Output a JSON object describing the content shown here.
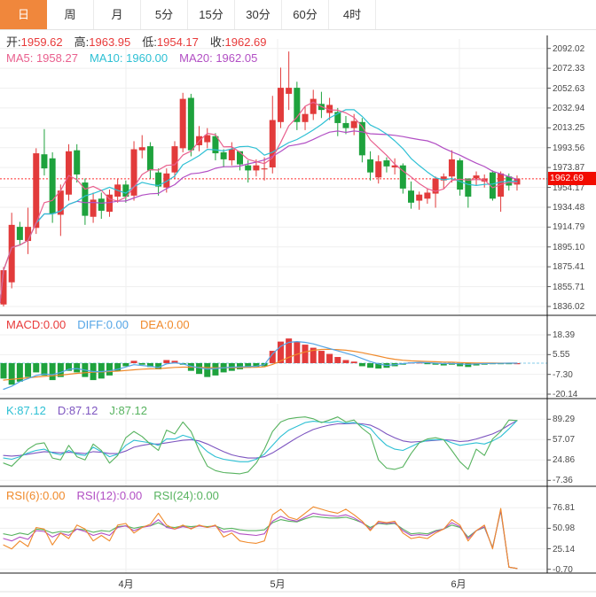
{
  "tabs": [
    {
      "label": "日",
      "selected": true
    },
    {
      "label": "周",
      "selected": false
    },
    {
      "label": "月",
      "selected": false
    },
    {
      "label": "5分",
      "selected": false
    },
    {
      "label": "15分",
      "selected": false
    },
    {
      "label": "30分",
      "selected": false
    },
    {
      "label": "60分",
      "selected": false
    },
    {
      "label": "4时",
      "selected": false
    }
  ],
  "ohlc_legend": [
    {
      "label": "开:",
      "value": "1959.62"
    },
    {
      "label": "高:",
      "value": "1963.95"
    },
    {
      "label": "低:",
      "value": "1954.17"
    },
    {
      "label": "收:",
      "value": "1962.69"
    }
  ],
  "ma_legend": [
    {
      "label": "MA5: ",
      "value": "1958.27",
      "color": "#e9608e"
    },
    {
      "label": "MA10: ",
      "value": "1960.00",
      "color": "#2ec0d4"
    },
    {
      "label": "MA20: ",
      "value": "1962.05",
      "color": "#b24fc4"
    }
  ],
  "macd_legend": [
    {
      "label": "MACD:",
      "value": "0.00",
      "color": "#e83a3a"
    },
    {
      "label": "DIFF:",
      "value": "0.00",
      "color": "#54a5e6"
    },
    {
      "label": "DEA:",
      "value": "0.00",
      "color": "#f08a2b"
    }
  ],
  "kdj_legend": [
    {
      "label": "K:",
      "value": "87.12",
      "color": "#2ec0d4"
    },
    {
      "label": "D:",
      "value": "87.12",
      "color": "#7d55c0"
    },
    {
      "label": "J:",
      "value": "87.12",
      "color": "#57b35f"
    }
  ],
  "rsi_legend": [
    {
      "label": "RSI(6):",
      "value": "0.00",
      "color": "#f08a2b"
    },
    {
      "label": "RSI(12):",
      "value": "0.00",
      "color": "#b24fc4"
    },
    {
      "label": "RSI(24):",
      "value": "0.00",
      "color": "#57b35f"
    }
  ],
  "current_price": "1962.69",
  "x_labels": [
    {
      "text": "4月",
      "x": 142
    },
    {
      "text": "5月",
      "x": 313
    },
    {
      "text": "6月",
      "x": 517
    }
  ],
  "colors": {
    "up": "#e23b3b",
    "down": "#1ea23d",
    "accent_tab": "#f0873c",
    "badge": "#f20c00",
    "grid": "#efefef",
    "panel_border": "#1a1a1a",
    "dotted_price_line": "#ff2d2d",
    "macd_zero_line": "#85cdea"
  },
  "chart_data": [
    {
      "type": "candlestick",
      "panel": "main",
      "y_ticks": [
        2092.02,
        2072.33,
        2052.63,
        2032.94,
        2013.25,
        1993.56,
        1973.87,
        1954.17,
        1934.48,
        1914.79,
        1895.1,
        1875.41,
        1855.71,
        1836.02
      ],
      "ylim": [
        1836.02,
        2092.02
      ],
      "x_tick_labels": [
        "4月",
        "5月",
        "6月"
      ],
      "current_price_line": 1962.69,
      "ma_overlays": [
        {
          "name": "MA5",
          "period": 5,
          "color": "#e9608e"
        },
        {
          "name": "MA10",
          "period": 10,
          "color": "#2ec0d4"
        },
        {
          "name": "MA20",
          "period": 20,
          "color": "#b24fc4"
        }
      ],
      "candles_ochl_note": "each row is [open, close, low, high]",
      "candles": [
        [
          1838,
          1872,
          1836,
          1875
        ],
        [
          1860,
          1917,
          1854,
          1929
        ],
        [
          1915,
          1902,
          1897,
          1920
        ],
        [
          1901,
          1915,
          1888,
          1934
        ],
        [
          1914,
          1988,
          1908,
          1993
        ],
        [
          1987,
          1973,
          1966,
          2012
        ],
        [
          1983,
          1928,
          1919,
          1989
        ],
        [
          1927,
          1951,
          1906,
          1957
        ],
        [
          1947,
          1990,
          1941,
          1997
        ],
        [
          1991,
          1967,
          1959,
          1997
        ],
        [
          1959,
          1926,
          1917,
          1963
        ],
        [
          1925,
          1942,
          1919,
          1949
        ],
        [
          1943,
          1931,
          1923,
          1949
        ],
        [
          1930,
          1947,
          1925,
          1952
        ],
        [
          1945,
          1957,
          1939,
          1963
        ],
        [
          1957,
          1945,
          1939,
          1961
        ],
        [
          1946,
          1992,
          1941,
          2000
        ],
        [
          1991,
          1994,
          1983,
          2006
        ],
        [
          1995,
          1971,
          1963,
          1999
        ],
        [
          1969,
          1955,
          1946,
          1973
        ],
        [
          1954,
          1968,
          1949,
          1973
        ],
        [
          1969,
          1995,
          1963,
          2000
        ],
        [
          1993,
          2042,
          1989,
          2048
        ],
        [
          2043,
          1991,
          1985,
          2047
        ],
        [
          1996,
          2005,
          1990,
          2015
        ],
        [
          1999,
          2006,
          1993,
          2013
        ],
        [
          2005,
          1988,
          1981,
          2008
        ],
        [
          1989,
          1982,
          1974,
          1992
        ],
        [
          1981,
          1992,
          1976,
          1999
        ],
        [
          1990,
          1977,
          1971,
          1990
        ],
        [
          1976,
          1971,
          1959,
          1981
        ],
        [
          1971,
          1976,
          1965,
          1982
        ],
        [
          1972,
          1973,
          1961,
          1984
        ],
        [
          1974,
          2021,
          1968,
          2045
        ],
        [
          2019,
          2053,
          2013,
          2073
        ],
        [
          2047,
          2053,
          2031,
          2089
        ],
        [
          2053,
          2019,
          2011,
          2059
        ],
        [
          2019,
          2027,
          2011,
          2035
        ],
        [
          2027,
          2042,
          2021,
          2051
        ],
        [
          2037,
          2031,
          2023,
          2049
        ],
        [
          2028,
          2036,
          2021,
          2043
        ],
        [
          2029,
          2018,
          2005,
          2033
        ],
        [
          2018,
          2013,
          2007,
          2025
        ],
        [
          2013,
          2020,
          2006,
          2027
        ],
        [
          2019,
          1986,
          1979,
          2023
        ],
        [
          1982,
          1969,
          1961,
          1990
        ],
        [
          1964,
          1980,
          1958,
          1986
        ],
        [
          1981,
          1975,
          1969,
          1984
        ],
        [
          1974,
          1976,
          1967,
          1983
        ],
        [
          1976,
          1953,
          1948,
          1978
        ],
        [
          1951,
          1939,
          1933,
          1960
        ],
        [
          1941,
          1947,
          1932,
          1950
        ],
        [
          1943,
          1949,
          1938,
          1953
        ],
        [
          1948,
          1963,
          1934,
          1965
        ],
        [
          1961,
          1965,
          1953,
          1968
        ],
        [
          1965,
          1982,
          1959,
          1991
        ],
        [
          1981,
          1952,
          1946,
          1983
        ],
        [
          1963,
          1945,
          1934,
          1963
        ],
        [
          1963,
          1966,
          1956,
          1970
        ],
        [
          1960,
          1963,
          1954,
          1967
        ],
        [
          1969,
          1943,
          1941,
          1971
        ],
        [
          1945,
          1968,
          1930,
          1970
        ],
        [
          1965,
          1956,
          1951,
          1968
        ],
        [
          1957,
          1963,
          1951,
          1966
        ]
      ]
    },
    {
      "type": "bar",
      "panel": "macd",
      "y_ticks": [
        18.39,
        5.55,
        -7.3,
        -20.14
      ],
      "histogram": [
        -10,
        -14,
        -12,
        -9,
        -6,
        -8,
        -11,
        -9,
        -5,
        -6,
        -9,
        -11,
        -10,
        -8,
        -5,
        -2,
        1.5,
        -1,
        -2.5,
        -4,
        2,
        1.5,
        -1,
        -5,
        -7,
        -9,
        -8,
        -6,
        -5,
        -4,
        -3,
        -2.5,
        -2,
        8,
        14,
        16,
        14,
        12,
        10,
        8,
        6,
        4,
        2,
        1,
        -2,
        -3,
        -3.5,
        -3,
        -2,
        -1,
        0.5,
        0.5,
        -0.5,
        -1,
        -1.5,
        -1,
        -2,
        -2.5,
        -1.5,
        -1,
        -0.5,
        -0.3,
        -0.2,
        0
      ],
      "series": [
        {
          "name": "DIFF",
          "color": "#54a5e6",
          "values": [
            -17,
            -15,
            -12,
            -10,
            -8,
            -7,
            -7.5,
            -6,
            -4,
            -3.5,
            -4.5,
            -5.5,
            -5.5,
            -5,
            -4,
            -2.5,
            -1,
            -1.5,
            -2,
            -2.8,
            -0.5,
            0.2,
            -0.5,
            -2,
            -3,
            -3.8,
            -3.5,
            -3,
            -2.6,
            -2.4,
            -2.2,
            -2,
            -1,
            6,
            11,
            13.5,
            14,
            13.5,
            12.5,
            11,
            9.5,
            8,
            6.5,
            5,
            3,
            1,
            -0.5,
            -1.5,
            -1,
            -0.3,
            0.2,
            0.5,
            0.3,
            0,
            -0.3,
            -0.2,
            -0.5,
            -0.8,
            -0.5,
            -0.3,
            -0.2,
            -0.1,
            0,
            0
          ]
        },
        {
          "name": "DEA",
          "color": "#f08a2b",
          "values": [
            -11,
            -10.5,
            -10,
            -9.5,
            -9,
            -8.6,
            -8.2,
            -7.8,
            -7.2,
            -6.6,
            -6.2,
            -5.9,
            -5.7,
            -5.5,
            -5.2,
            -4.8,
            -4.3,
            -3.9,
            -3.7,
            -3.6,
            -3.2,
            -2.8,
            -2.6,
            -2.6,
            -2.7,
            -2.9,
            -3,
            -3,
            -3,
            -2.9,
            -2.8,
            -2.7,
            -2.4,
            -0.8,
            1.5,
            3.8,
            5.8,
            7.3,
            8.3,
            8.9,
            9,
            8.8,
            8.4,
            7.7,
            6.8,
            5.7,
            4.6,
            3.4,
            2.5,
            1.9,
            1.5,
            1.3,
            1.1,
            0.9,
            0.7,
            0.6,
            0.4,
            0.2,
            0.1,
            0.1,
            0.05,
            0,
            0,
            0
          ]
        }
      ]
    },
    {
      "type": "line",
      "panel": "kdj",
      "y_ticks": [
        89.29,
        57.07,
        24.86,
        -7.36
      ],
      "series": [
        {
          "name": "D",
          "color": "#7d55c0",
          "values": [
            32,
            31,
            32,
            34,
            36,
            38,
            37,
            36,
            37,
            36,
            35,
            38,
            37,
            35,
            35,
            39,
            45,
            48,
            50,
            50,
            52,
            54,
            56,
            57,
            55,
            50,
            44,
            38,
            33,
            30,
            28,
            28,
            30,
            36,
            44,
            52,
            60,
            67,
            73,
            77,
            80,
            82,
            82,
            83,
            82,
            80,
            74,
            66,
            60,
            55,
            53,
            54,
            55,
            56,
            57,
            56,
            54,
            55,
            58,
            62,
            66,
            72,
            80,
            87.12
          ]
        },
        {
          "name": "K",
          "color": "#2ec0d4",
          "values": [
            28,
            26,
            30,
            36,
            40,
            42,
            36,
            33,
            40,
            34,
            32,
            45,
            38,
            30,
            34,
            48,
            56,
            54,
            52,
            48,
            58,
            58,
            64,
            60,
            50,
            38,
            30,
            26,
            24,
            22,
            22,
            26,
            34,
            48,
            62,
            72,
            78,
            84,
            86,
            85,
            84,
            86,
            83,
            84,
            80,
            75,
            60,
            48,
            42,
            40,
            46,
            52,
            56,
            57,
            57,
            52,
            48,
            50,
            52,
            50,
            55,
            62,
            74,
            87.12
          ]
        },
        {
          "name": "J",
          "color": "#57b35f",
          "values": [
            20,
            15,
            28,
            42,
            50,
            52,
            28,
            25,
            48,
            30,
            25,
            50,
            40,
            20,
            32,
            60,
            70,
            62,
            50,
            40,
            72,
            66,
            85,
            70,
            40,
            15,
            8,
            5,
            4,
            3,
            6,
            20,
            42,
            70,
            85,
            90,
            92,
            93,
            90,
            84,
            88,
            93,
            85,
            88,
            75,
            65,
            25,
            12,
            10,
            14,
            35,
            52,
            58,
            60,
            57,
            40,
            22,
            10,
            42,
            32,
            58,
            70,
            88,
            87.12
          ]
        }
      ]
    },
    {
      "type": "line",
      "panel": "rsi",
      "y_ticks": [
        76.81,
        50.98,
        25.14,
        -0.7
      ],
      "series": [
        {
          "name": "RSI24",
          "color": "#57b35f",
          "values": [
            44,
            42,
            45,
            43,
            50,
            49,
            45,
            47,
            46,
            50,
            49,
            46,
            48,
            47,
            53,
            54,
            51,
            53,
            54,
            58,
            53,
            52,
            54,
            53,
            54,
            53,
            54,
            50,
            51,
            49,
            48,
            48,
            49,
            58,
            62,
            60,
            59,
            63,
            66,
            65,
            64,
            64,
            65,
            62,
            58,
            52,
            57,
            56,
            57,
            50,
            44,
            45,
            44,
            48,
            50,
            55,
            52,
            40,
            48,
            52,
            27,
            73,
            2,
            0.3
          ]
        },
        {
          "name": "RSI12",
          "color": "#b24fc4",
          "values": [
            38,
            35,
            40,
            37,
            48,
            47,
            40,
            45,
            42,
            50,
            47,
            42,
            45,
            42,
            52,
            54,
            48,
            52,
            54,
            62,
            52,
            50,
            53,
            51,
            54,
            52,
            54,
            46,
            48,
            44,
            43,
            42,
            44,
            60,
            66,
            62,
            60,
            65,
            70,
            68,
            67,
            66,
            68,
            64,
            58,
            50,
            58,
            57,
            58,
            48,
            42,
            43,
            42,
            47,
            50,
            58,
            53,
            38,
            48,
            53,
            26,
            74,
            2,
            0.3
          ]
        },
        {
          "name": "RSI6",
          "color": "#f08a2b",
          "values": [
            30,
            25,
            35,
            28,
            52,
            50,
            30,
            45,
            38,
            55,
            50,
            35,
            42,
            35,
            55,
            57,
            45,
            52,
            56,
            70,
            55,
            50,
            55,
            50,
            55,
            52,
            55,
            40,
            45,
            35,
            33,
            32,
            35,
            68,
            75,
            65,
            62,
            70,
            78,
            75,
            72,
            70,
            75,
            68,
            60,
            48,
            60,
            58,
            60,
            45,
            38,
            40,
            38,
            45,
            50,
            62,
            55,
            35,
            48,
            55,
            25,
            76,
            2,
            0.3
          ]
        }
      ]
    }
  ]
}
